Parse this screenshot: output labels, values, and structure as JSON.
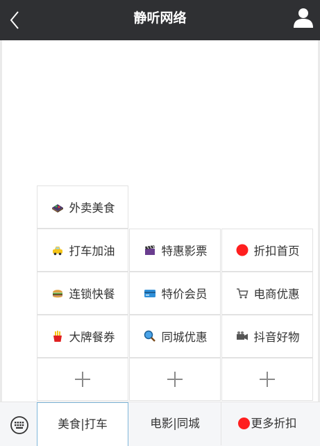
{
  "header": {
    "title": "静听网络"
  },
  "grid": {
    "rows": [
      [
        {
          "label": "外卖美食",
          "icon": "takeout-icon"
        }
      ],
      [
        {
          "label": "打车加油",
          "icon": "taxi-icon"
        },
        {
          "label": "特惠影票",
          "icon": "clapper-icon"
        },
        {
          "label": "折扣首页",
          "icon": "red-dot-icon"
        }
      ],
      [
        {
          "label": "连锁快餐",
          "icon": "burger-icon"
        },
        {
          "label": "特价会员",
          "icon": "card-icon"
        },
        {
          "label": "电商优惠",
          "icon": "cart-icon"
        }
      ],
      [
        {
          "label": "大牌餐券",
          "icon": "fries-icon"
        },
        {
          "label": "同城优惠",
          "icon": "magnifier-icon"
        },
        {
          "label": "抖音好物",
          "icon": "camera-icon"
        }
      ]
    ],
    "add_slots": 3
  },
  "tabbar": {
    "tabs": [
      {
        "label": "美食|打车",
        "active": true
      },
      {
        "label": "电影|同城",
        "active": false
      },
      {
        "label": "更多折扣",
        "active": false
      }
    ]
  },
  "colors": {
    "header_bg": "#2f3033",
    "active_tab_border": "#7fb6d9",
    "accent_red": "#ff1f1f"
  }
}
